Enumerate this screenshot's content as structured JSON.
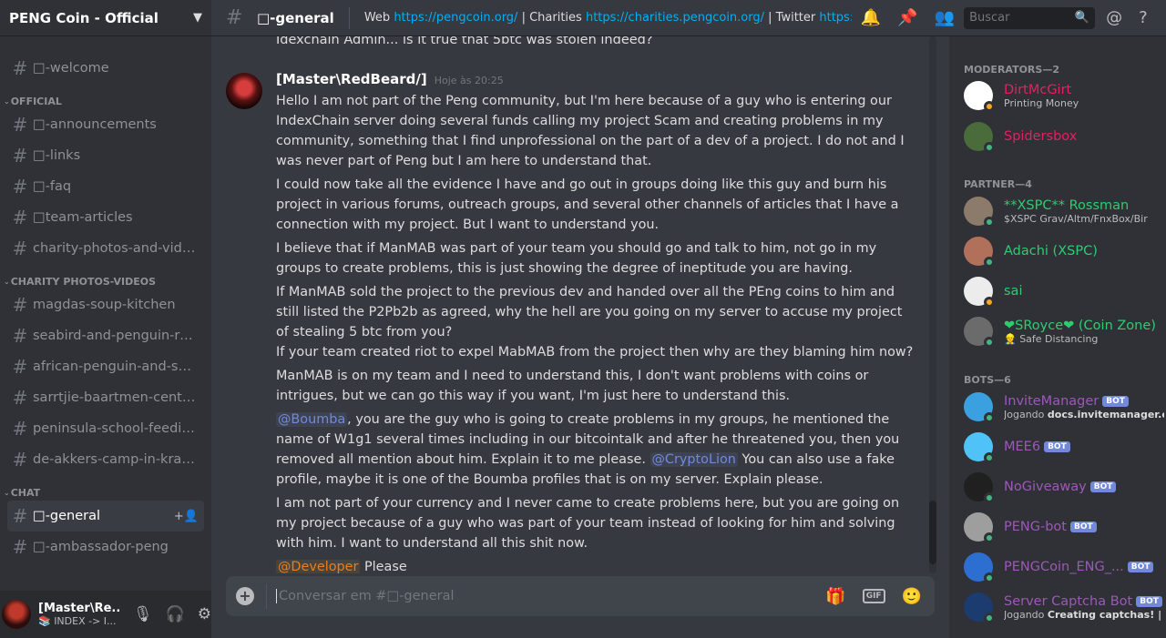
{
  "guild": {
    "name": "PENG Coin - Official"
  },
  "sidebar": {
    "top_channels": [
      {
        "label": "□-welcome"
      }
    ],
    "categories": [
      {
        "name": "OFFICIAL",
        "channels": [
          {
            "label": "□-announcements"
          },
          {
            "label": "□-links"
          },
          {
            "label": "□-faq"
          },
          {
            "label": "□team-articles"
          },
          {
            "label": "charity-photos-and-videos"
          }
        ]
      },
      {
        "name": "CHARITY PHOTOS-VIDEOS",
        "channels": [
          {
            "label": "magdas-soup-kitchen"
          },
          {
            "label": "seabird-and-penguin-reh..."
          },
          {
            "label": "african-penguin-and-sea..."
          },
          {
            "label": "sarrtjie-baartmen-center..."
          },
          {
            "label": "peninsula-school-feeding..."
          },
          {
            "label": "de-akkers-camp-in-kraai..."
          }
        ]
      },
      {
        "name": "CHAT",
        "channels": [
          {
            "label": "□-general",
            "active": true
          },
          {
            "label": "□-ambassador-peng"
          }
        ]
      }
    ]
  },
  "user": {
    "name": "[Master\\Re...",
    "status": "📚 INDEX -> I..."
  },
  "topbar": {
    "channel": "□-general",
    "topic_web_label": "Web ",
    "topic_web_url": "https://pengcoin.org/",
    "topic_char_label": " | Charities ",
    "topic_char_url": "https://charities.pengcoin.org/",
    "topic_tw_label": " | Twitter ",
    "topic_tw_url": "https://t...",
    "search_placeholder": "Buscar"
  },
  "chat": {
    "previous_line": "Idexchain Admin... is it true that 5btc was stolen indeed?",
    "message": {
      "author": "[Master\\RedBeard/]",
      "timestamp": "Hoje às 20:25",
      "p1": "Hello I am not part of the Peng community, but I'm here because of a guy who is entering our IndexChain server doing several funds calling my project Scam and creating problems in my community, something that I find unprofessional on the part of a dev of a project. I do not and I was never part of Peng but I am here to understand that.",
      "p2": "I could now take all the evidence I have and go out in groups doing like this guy and burn his project in various forums, outreach groups, and several other channels of articles that I have a connection with my project. But I want to understand you.",
      "p3": "I believe that if ManMAB was part of your team you should go and talk to him, not go in my groups to create problems, this is just showing the degree of ineptitude you are having.",
      "p4": "If ManMAB sold the project to the previous dev and handed over all the PEng coins to him and still listed the P2Pb2b as agreed, why the hell are you going on my server to accuse my project of stealing 5 btc from you?",
      "p5": "If your team created riot to expel MabMAB from the project then why are they blaming him now?",
      "p6": "ManMAB is on my team and I need to understand this, I don't want problems with coins or intrigues, but we can go this way if you want, I'm just here to understand this.",
      "p7_mention1": "@Boumba",
      "p7_text1": ", you are the guy who is going to create problems in my groups, he mentioned the name of W1g1 several times including in our bitcointalk and after he threatened you, then you removed all mention about him. Explain it to me please. ",
      "p7_mention2": "@CryptoLion",
      "p7_text2": " You can also use a fake profile, maybe it is one of the Boumba profiles that is on my server. Explain please.",
      "p8": "I am not part of your currency and I never came to create problems here, but you are going on my project because of a guy who was part of your team instead of looking for him and solving with him. I want to understand all this shit now.",
      "p9_mention": "@Developer",
      "p9_text": " Please"
    },
    "composer_placeholder": "Conversar em #□-general"
  },
  "members": {
    "groups": [
      {
        "title": "MODERATORS—2",
        "items": [
          {
            "name": "DirtMcGirt",
            "sub": "Printing Money",
            "color": "#e91e63",
            "status": "#faa61a"
          },
          {
            "name": "Spidersbox",
            "sub": "",
            "color": "#e91e63",
            "status": "#43b581"
          }
        ]
      },
      {
        "title": "PARTNER—4",
        "items": [
          {
            "name": "**XSPC** Rossman",
            "sub": "$XSPC Grav/Altm/FnxBox/Bir",
            "color": "#2ecc71",
            "status": "#43b581"
          },
          {
            "name": "Adachi (XSPC)",
            "sub": "",
            "color": "#2ecc71",
            "status": "#43b581"
          },
          {
            "name": "sai",
            "sub": "",
            "color": "#2ecc71",
            "status": "#faa61a"
          },
          {
            "name": "❤SRoyce❤ (Coin Zone)",
            "sub": "👷 Safe Distancing",
            "color": "#2ecc71",
            "status": "#43b581"
          }
        ]
      },
      {
        "title": "BOTS—6",
        "items": [
          {
            "name": "InviteManager",
            "sub_pre": "Jogando ",
            "sub_b": "docs.invitemanager.co!",
            "color": "#9b59b6",
            "status": "#43b581",
            "bot": "BOT"
          },
          {
            "name": "MEE6",
            "color": "#9b59b6",
            "status": "#43b581",
            "bot": "BOT"
          },
          {
            "name": "NoGiveaway",
            "color": "#9b59b6",
            "status": "#43b581",
            "bot": "BOT"
          },
          {
            "name": "PENG-bot",
            "color": "#9b59b6",
            "status": "#43b581",
            "bot": "BOT"
          },
          {
            "name": "PENGCoin_ENG_...",
            "color": "#9b59b6",
            "status": "#43b581",
            "bot": "BOT"
          },
          {
            "name": "Server Captcha Bot",
            "sub_pre": "Jogando ",
            "sub_b": "Creating captchas! | P...",
            "color": "#9b59b6",
            "status": "#43b581",
            "bot": "BOT"
          }
        ]
      }
    ]
  }
}
